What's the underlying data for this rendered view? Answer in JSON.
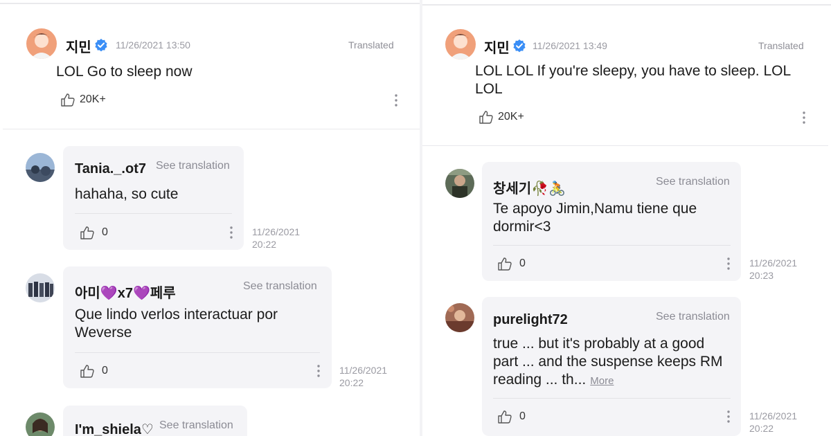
{
  "left": {
    "post": {
      "author": "지민",
      "timestamp": "11/26/2021 13:50",
      "translated_label": "Translated",
      "body": "LOL Go to sleep now",
      "likes": "20K+"
    },
    "comments": [
      {
        "author": "Tania._.ot7",
        "see_translation": "See translation",
        "text": "hahaha, so cute",
        "likes": "0",
        "date": "11/26/2021",
        "time": "20:22"
      },
      {
        "author": "아미💜x7💜페루",
        "see_translation": "See translation",
        "text": "Que lindo verlos interactuar por Weverse",
        "likes": "0",
        "date": "11/26/2021",
        "time": "20:22"
      },
      {
        "author": "I'm_shiela♡",
        "see_translation": "See translation"
      }
    ]
  },
  "right": {
    "post": {
      "author": "지민",
      "timestamp": "11/26/2021 13:49",
      "translated_label": "Translated",
      "body": "LOL LOL If you're sleepy, you have to sleep. LOL LOL",
      "likes": "20K+"
    },
    "comments": [
      {
        "author": "창세기🥀🚴",
        "see_translation": "See translation",
        "text": "Te apoyo Jimin,Namu tiene que dormir<3",
        "likes": "0",
        "date": "11/26/2021",
        "time": "20:23"
      },
      {
        "author": "purelight72",
        "see_translation": "See translation",
        "text": "true ... but it's probably at a good part ... and the suspense keeps RM reading ... th...",
        "more": "More",
        "likes": "0",
        "date": "11/26/2021",
        "time": "20:22"
      }
    ]
  },
  "colors": {
    "verified_badge": "#3a8ef6",
    "bubble_bg": "#f4f4f7",
    "muted_text": "#9a9aa2"
  },
  "icons": {
    "verified": "verified-badge-icon",
    "like": "thumbs-up-icon",
    "menu": "more-vertical-icon"
  }
}
